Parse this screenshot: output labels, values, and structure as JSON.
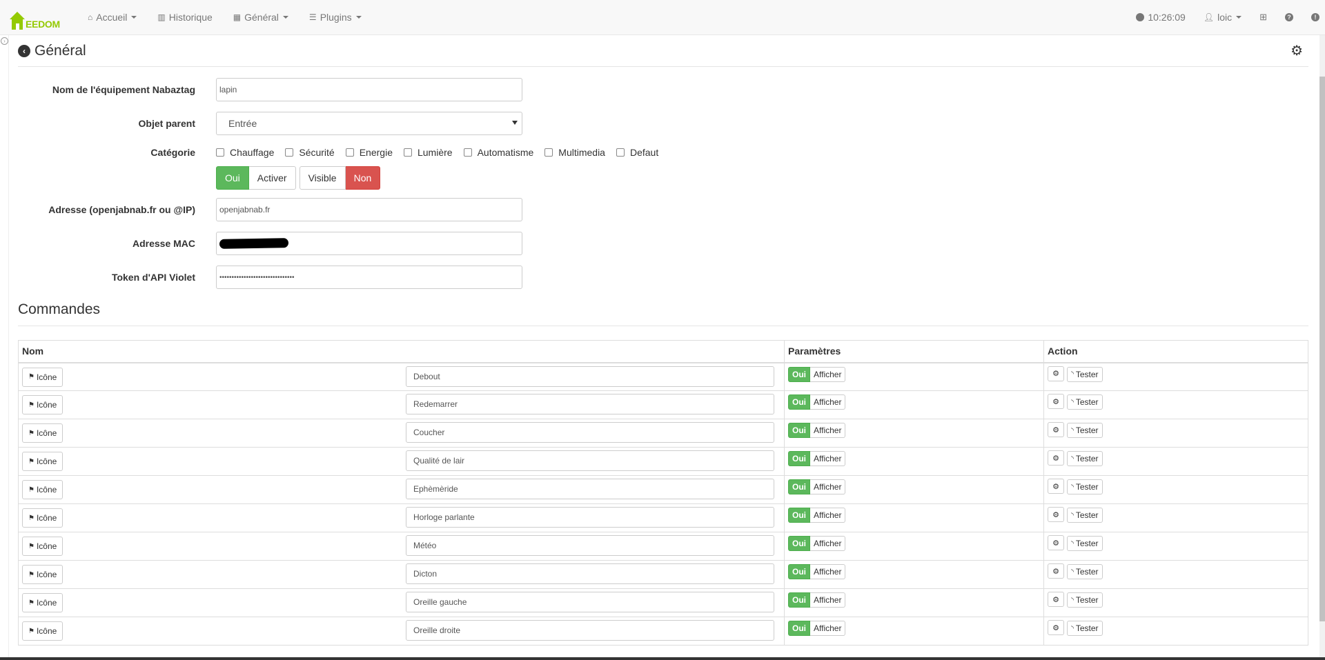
{
  "brand": {
    "name": "EEDOM",
    "color": "#94ca02"
  },
  "nav": {
    "items": [
      {
        "label": "Accueil",
        "icon": "home-icon",
        "glyph": "⌂",
        "dropdown": true
      },
      {
        "label": "Historique",
        "icon": "bar-chart-icon",
        "glyph": "▥",
        "dropdown": false
      },
      {
        "label": "Général",
        "icon": "grid-icon",
        "glyph": "▦",
        "dropdown": true
      },
      {
        "label": "Plugins",
        "icon": "list-icon",
        "glyph": "☰",
        "dropdown": true
      }
    ],
    "time": "10:26:09",
    "user": "loic"
  },
  "page": {
    "title": "Général",
    "fields": {
      "name": {
        "label": "Nom de l'équipement Nabaztag",
        "value": "lapin"
      },
      "parent": {
        "label": "Objet parent",
        "value": "Entrée"
      },
      "category": {
        "label": "Catégorie",
        "options": [
          "Chauffage",
          "Sécurité",
          "Energie",
          "Lumière",
          "Automatisme",
          "Multimedia",
          "Defaut"
        ]
      },
      "toggles": {
        "activate_on": "Oui",
        "activate_label": "Activer",
        "visible_label": "Visible",
        "visible_off": "Non"
      },
      "address": {
        "label": "Adresse (openjabnab.fr ou @IP)",
        "value": "openjabnab.fr"
      },
      "mac": {
        "label": "Adresse MAC"
      },
      "token": {
        "label": "Token d'API Violet",
        "value": "•••••••••••••••••••••••••••••••"
      }
    }
  },
  "commands": {
    "title": "Commandes",
    "headers": {
      "name": "Nom",
      "params": "Paramètres",
      "action": "Action"
    },
    "icon_label": "Icône",
    "oui": "Oui",
    "afficher": "Afficher",
    "tester": "Tester",
    "rows": [
      "Debout",
      "Redemarrer",
      "Coucher",
      "Qualité de lair",
      "Ephèmèride",
      "Horloge parlante",
      "Météo",
      "Dicton",
      "Oreille gauche",
      "Oreille droite"
    ]
  }
}
